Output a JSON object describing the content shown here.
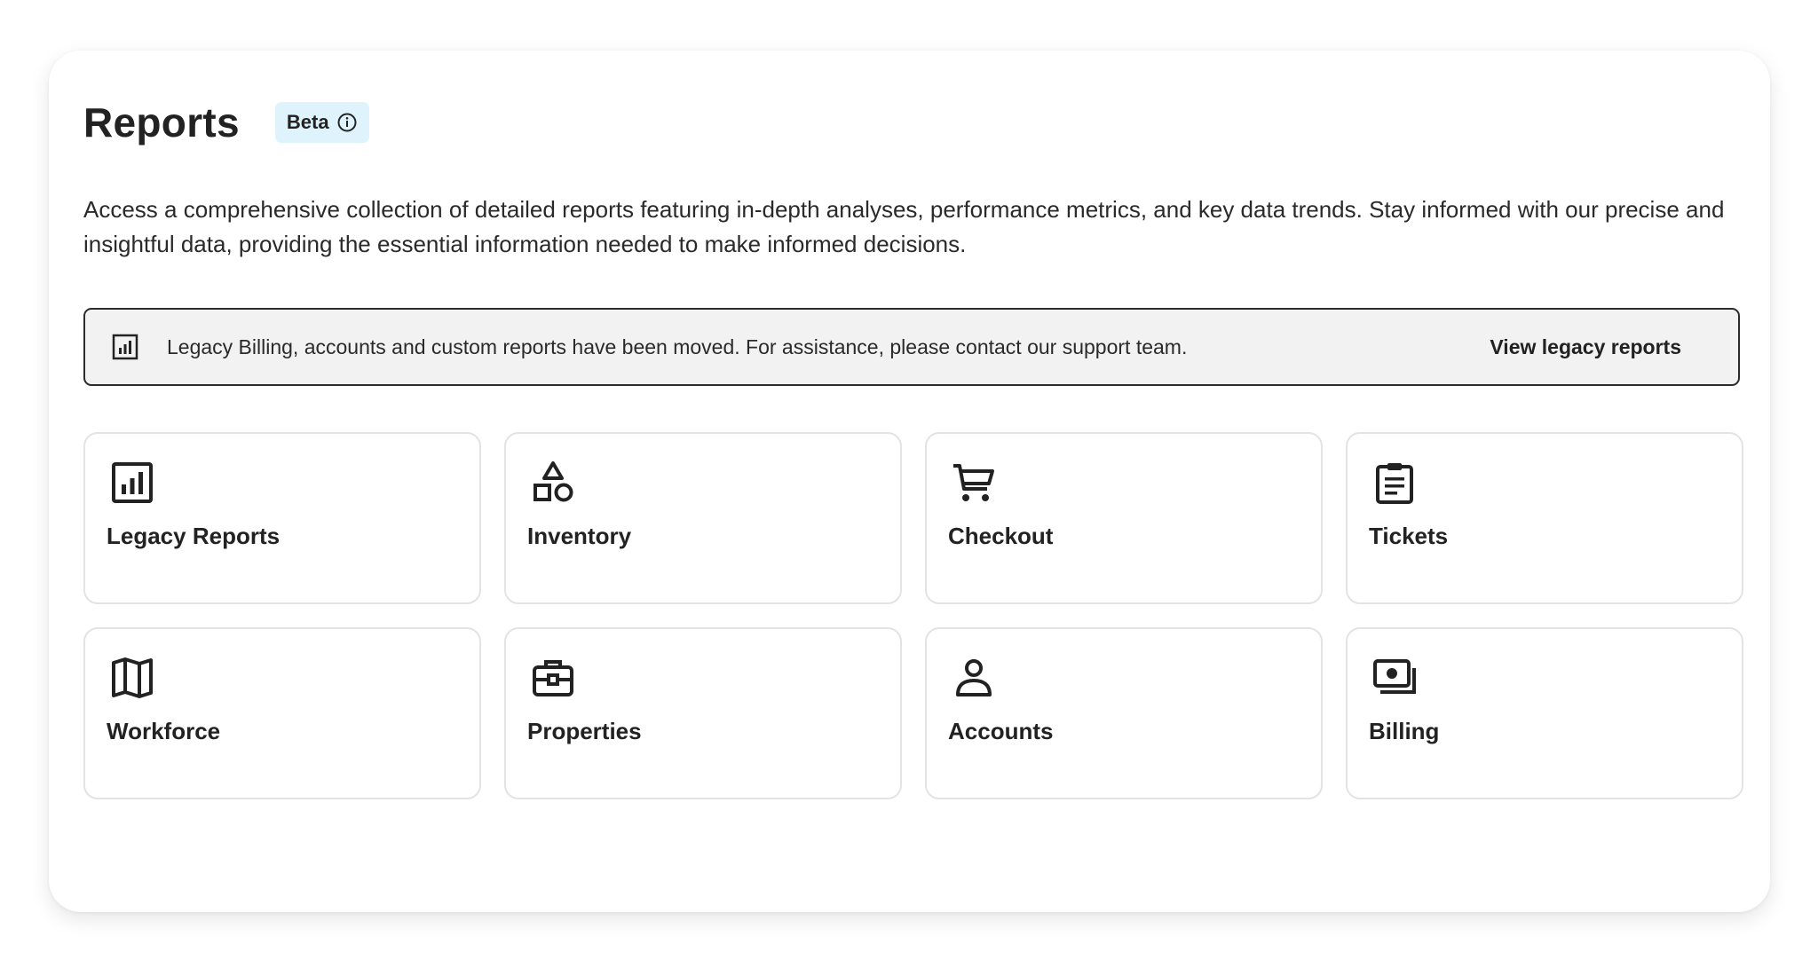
{
  "header": {
    "title": "Reports",
    "badge": "Beta"
  },
  "description": "Access a comprehensive collection of detailed reports featuring in-depth analyses, performance metrics, and key data trends. Stay informed with our precise and insightful data, providing the essential information needed to make informed decisions.",
  "notice": {
    "icon": "bar-chart-icon",
    "text": "Legacy Billing, accounts and custom reports have been moved. For assistance, please contact our support team.",
    "link_label": "View legacy reports"
  },
  "tiles": [
    {
      "label": "Legacy Reports",
      "icon": "bar-chart-icon"
    },
    {
      "label": "Inventory",
      "icon": "shapes-icon"
    },
    {
      "label": "Checkout",
      "icon": "shopping-cart-icon"
    },
    {
      "label": "Tickets",
      "icon": "clipboard-icon"
    },
    {
      "label": "Workforce",
      "icon": "map-icon"
    },
    {
      "label": "Properties",
      "icon": "briefcase-icon"
    },
    {
      "label": "Accounts",
      "icon": "user-icon"
    },
    {
      "label": "Billing",
      "icon": "money-icon"
    }
  ],
  "colors": {
    "badge_bg": "#dff3fc",
    "notice_bg": "#f2f2f2",
    "text": "#222222",
    "tile_border": "#e3e3e3"
  }
}
